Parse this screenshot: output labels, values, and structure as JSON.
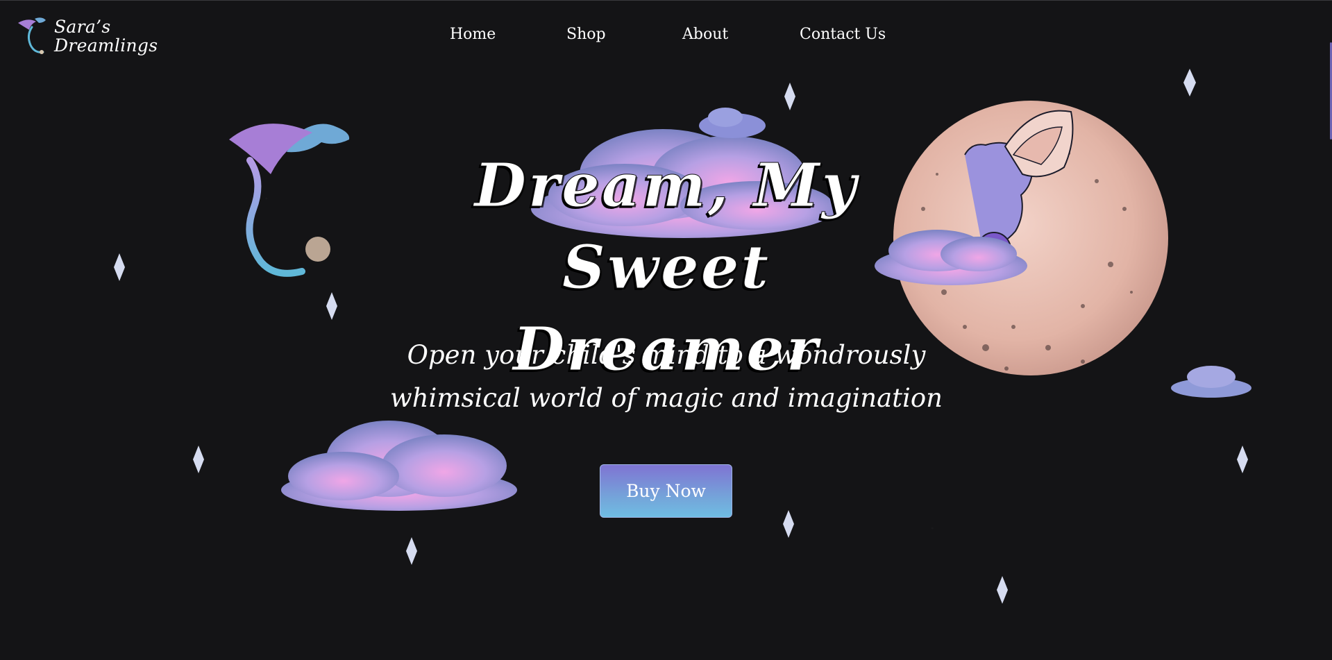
{
  "brand": {
    "line1": "Sara’s",
    "line2": "Dreamlings",
    "logo_icon": "dragon-logo-icon"
  },
  "nav": {
    "items": [
      {
        "label": "Home"
      },
      {
        "label": "Shop"
      },
      {
        "label": "About"
      },
      {
        "label": "Contact Us"
      }
    ]
  },
  "hero": {
    "title_line1": "Dream, My Sweet",
    "title_line2": "Dreamer",
    "subtitle_line1": "Open your child's mind to a wondrously",
    "subtitle_line2": "whimsical world of magic and imagination",
    "cta_label": "Buy Now"
  },
  "decor": {
    "icons": [
      "flying-dragon-icon",
      "moon-icon",
      "moon-dragon-icon",
      "cloud-icon",
      "sparkle-star-icon"
    ]
  },
  "colors": {
    "background": "#141416",
    "cta_top": "#7f74d3",
    "cta_bottom": "#6fbde3",
    "cloud_pink": "#e9a6e0",
    "cloud_lavender": "#a89be0",
    "moon": "#e9c3b8",
    "star": "#d6dcf0"
  }
}
